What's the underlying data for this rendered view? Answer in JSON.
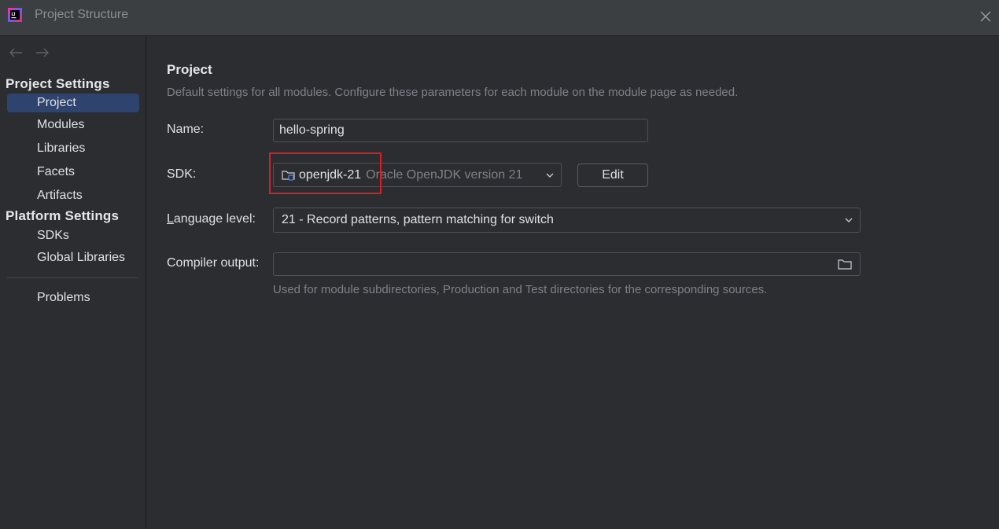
{
  "window": {
    "title": "Project Structure"
  },
  "sidebar": {
    "project_settings_title": "Project Settings",
    "project_settings_items": [
      {
        "label": "Project",
        "selected": true
      },
      {
        "label": "Modules"
      },
      {
        "label": "Libraries"
      },
      {
        "label": "Facets"
      },
      {
        "label": "Artifacts"
      }
    ],
    "platform_settings_title": "Platform Settings",
    "platform_settings_items": [
      {
        "label": "SDKs"
      },
      {
        "label": "Global Libraries"
      }
    ],
    "problems_label": "Problems"
  },
  "main": {
    "title": "Project",
    "description": "Default settings for all modules. Configure these parameters for each module on the module page as needed.",
    "name_label": "Name:",
    "name_value": "hello-spring",
    "sdk_label": "SDK:",
    "sdk_name": "openjdk-21",
    "sdk_detail": "Oracle OpenJDK version 21",
    "edit_label": "Edit",
    "language_level_label_mnemonic": "L",
    "language_level_label_rest": "anguage level:",
    "language_level_value": "21 - Record patterns, pattern matching for switch",
    "compiler_output_label": "Compiler output:",
    "compiler_output_value": "",
    "compiler_output_hint": "Used for module subdirectories, Production and Test directories for the corresponding sources."
  },
  "colors": {
    "background": "#2b2d30",
    "selection": "#2e436e",
    "highlight": "#e01b24"
  },
  "icons": [
    "app-logo-icon",
    "close-icon",
    "back-arrow-icon",
    "forward-arrow-icon",
    "jdk-folder-icon",
    "chevron-down-icon",
    "folder-icon"
  ]
}
